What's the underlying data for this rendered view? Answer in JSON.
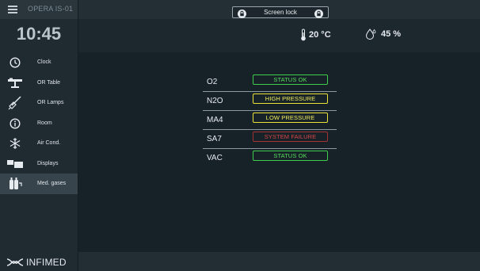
{
  "header": {
    "device_name": "OPERA IS-01",
    "screen_lock_label": "Screen lock"
  },
  "clock": "10:45",
  "environment": {
    "temperature": "20 °C",
    "humidity": "45 %"
  },
  "sidebar": {
    "items": [
      {
        "label": "Clock",
        "icon": "clock-icon"
      },
      {
        "label": "OR Table",
        "icon": "or-table-icon"
      },
      {
        "label": "OR Lamps",
        "icon": "or-lamp-icon"
      },
      {
        "label": "Room",
        "icon": "info-icon"
      },
      {
        "label": "Air Cond.",
        "icon": "snowflake-icon"
      },
      {
        "label": "Displays",
        "icon": "displays-icon"
      },
      {
        "label": "Med. gases",
        "icon": "gas-cylinders-icon"
      }
    ],
    "active_item": "Med. gases"
  },
  "gases": [
    {
      "name": "O2",
      "status": "STATUS OK",
      "level": "ok"
    },
    {
      "name": "N2O",
      "status": "HIGH PRESSURE",
      "level": "warning"
    },
    {
      "name": "MA4",
      "status": "LOW PRESSURE",
      "level": "warning"
    },
    {
      "name": "SA7",
      "status": "SYSTEM FAILURE",
      "level": "failure"
    },
    {
      "name": "VAC",
      "status": "STATUS OK",
      "level": "ok"
    }
  ],
  "logo": {
    "text": "INFIMED"
  },
  "colors": {
    "ok": "#3fcc4a",
    "warning": "#e8e23a",
    "failure": "#a43232",
    "background": "#172128"
  }
}
